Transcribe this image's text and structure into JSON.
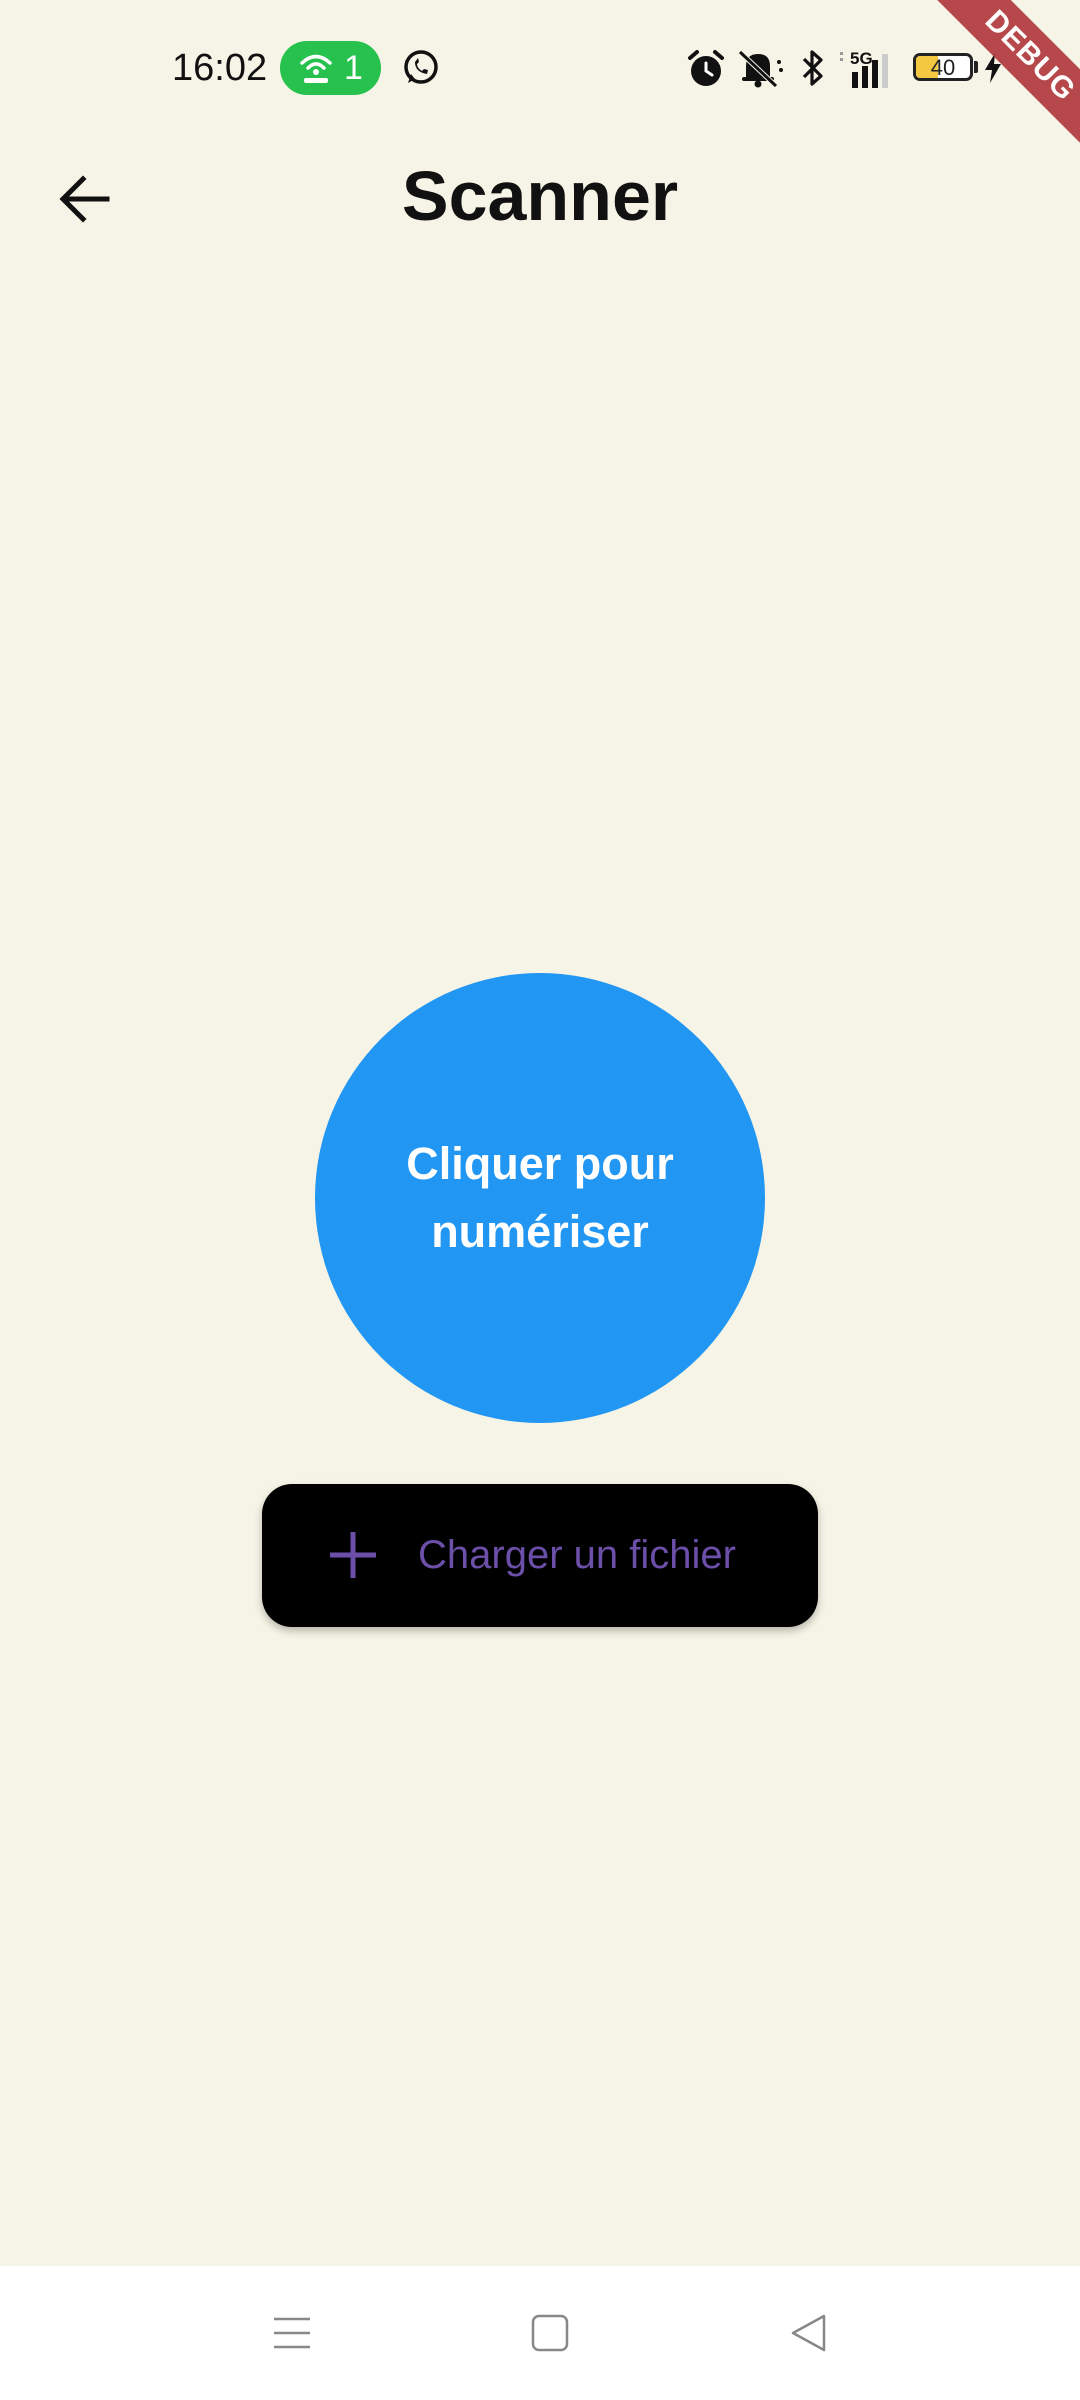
{
  "status_bar": {
    "time": "16:02",
    "hotspot_count": "1",
    "battery_level": "40",
    "battery_fraction": 0.4,
    "network_label": "5G",
    "icons": [
      "whatsapp-icon",
      "alarm-icon",
      "notifications-muted-icon",
      "bluetooth-icon",
      "signal-icon",
      "battery-icon",
      "charging-icon"
    ]
  },
  "debug_banner": "DEBUG",
  "app_bar": {
    "title": "Scanner",
    "back_icon": "arrow-back-icon"
  },
  "scan_button": {
    "label": "Cliquer pour numériser",
    "color": "#2196F3"
  },
  "upload_button": {
    "label": "Charger un fichier",
    "icon": "plus-icon",
    "text_color": "#6B4FA8",
    "background": "#000000"
  },
  "nav_bar": {
    "items": [
      "menu-icon",
      "home-icon",
      "back-icon"
    ]
  },
  "colors": {
    "background": "#F5F4E6",
    "debug_banner": "#B0363B",
    "hotspot_pill": "#27C14E"
  }
}
